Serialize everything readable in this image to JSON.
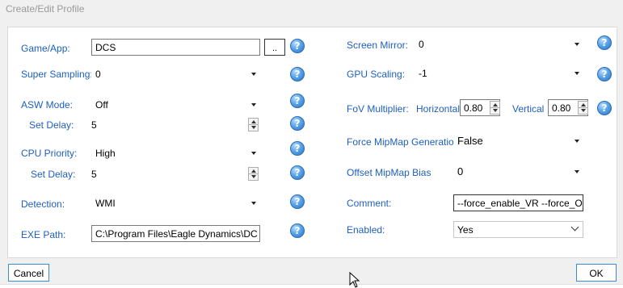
{
  "window": {
    "title": "Create/Edit Profile"
  },
  "left": {
    "game_app_label": "Game/App:",
    "game_app_value": "DCS",
    "browse_label": "..",
    "super_sampling_label": "Super Sampling:",
    "super_sampling_value": "0",
    "asw_mode_label": "ASW Mode:",
    "asw_mode_value": "Off",
    "asw_set_delay_label": "Set Delay:",
    "asw_set_delay_value": "5",
    "cpu_priority_label": "CPU Priority:",
    "cpu_priority_value": "High",
    "cpu_set_delay_label": "Set Delay:",
    "cpu_set_delay_value": "5",
    "detection_label": "Detection:",
    "detection_value": "WMI",
    "exe_path_label": "EXE Path:",
    "exe_path_value": "C:\\Program Files\\Eagle Dynamics\\DC"
  },
  "right": {
    "screen_mirror_label": "Screen Mirror:",
    "screen_mirror_value": "0",
    "gpu_scaling_label": "GPU Scaling:",
    "gpu_scaling_value": "-1",
    "fov_multiplier_label": "FoV Multiplier:",
    "fov_horizontal_label": "Horizontal",
    "fov_horizontal_value": "0.80",
    "fov_vertical_label": "Vertical",
    "fov_vertical_value": "0.80",
    "force_mipmap_label": "Force MipMap Generation",
    "force_mipmap_value": "False",
    "offset_mipmap_label": "Offset MipMap Bias",
    "offset_mipmap_value": "0",
    "comment_label": "Comment:",
    "comment_value": "--force_enable_VR --force_O",
    "enabled_label": "Enabled:",
    "enabled_value": "Yes"
  },
  "help_glyph": "?",
  "footer": {
    "cancel_label": "Cancel",
    "ok_label": "OK"
  },
  "colors": {
    "label_blue": "#1f5fbf",
    "accent_border": "#3b8ad6",
    "help_icon": "#2a72c4"
  }
}
